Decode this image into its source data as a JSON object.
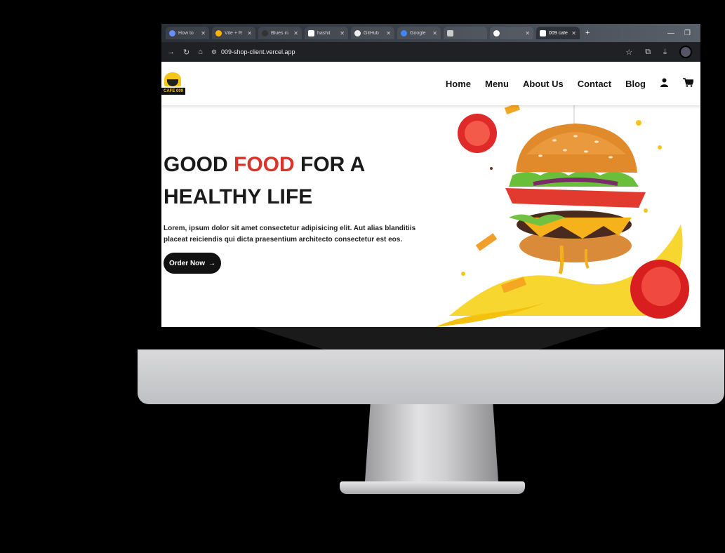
{
  "browser": {
    "tabs": [
      {
        "label": "How to",
        "active": false
      },
      {
        "label": "Vite + R",
        "active": false
      },
      {
        "label": "Blues in",
        "active": false
      },
      {
        "label": "hashit",
        "active": false
      },
      {
        "label": "GitHub",
        "active": false
      },
      {
        "label": "Google",
        "active": false
      },
      {
        "label": "",
        "active": false
      },
      {
        "label": "",
        "active": false
      },
      {
        "label": "009 cafe",
        "active": true
      }
    ],
    "url": "009-shop-client.vercel.app"
  },
  "site": {
    "logo_text": "CAFE 009",
    "nav": [
      "Home",
      "Menu",
      "About Us",
      "Contact",
      "Blog"
    ],
    "hero": {
      "headline_part1": "GOOD ",
      "headline_accent": "FOOD",
      "headline_part2": " FOR A",
      "headline_line2": "HEALTHY LIFE",
      "lead": "Lorem, ipsum dolor sit amet consectetur adipisicing elit. Aut alias blanditiis placeat reiciendis qui dicta praesentium architecto consectetur est eos.",
      "cta": "Order Now"
    }
  },
  "colors": {
    "accent": "#d8342c",
    "cta_bg": "#111111",
    "logo_yellow": "#f5c518"
  }
}
